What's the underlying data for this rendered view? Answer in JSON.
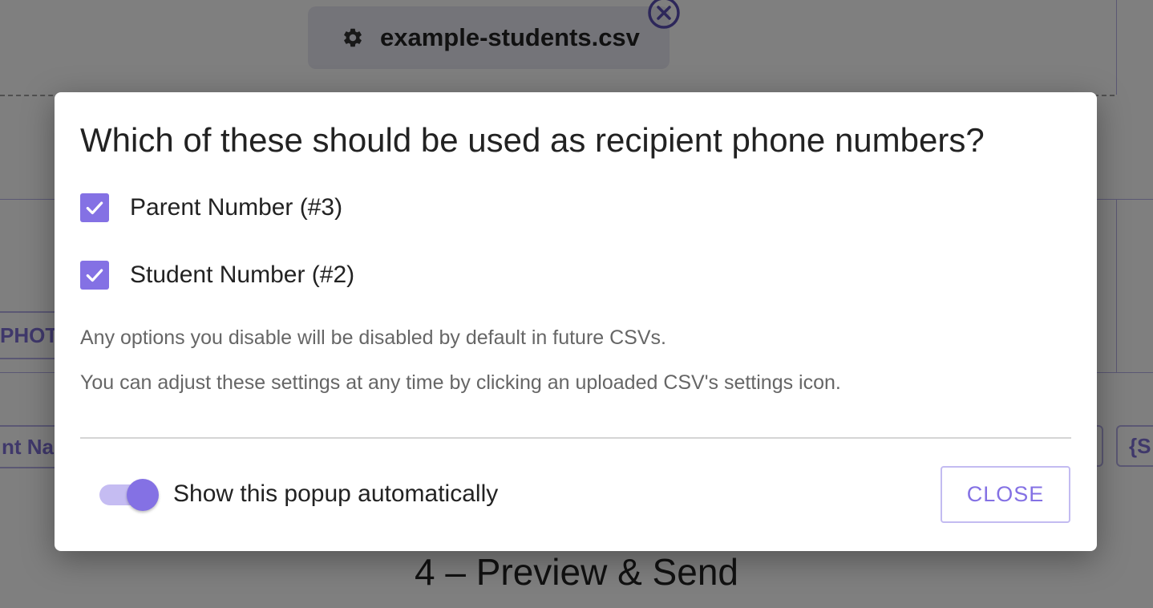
{
  "background": {
    "file_chip": {
      "filename": "example-students.csv",
      "settings_icon": "gear-icon",
      "remove_icon": "circle-x-icon"
    },
    "tags": {
      "photo_fragment": "PHOTO",
      "name_fragment": "nt Na",
      "right_fragment": "{S"
    },
    "step_heading": "4 – Preview & Send"
  },
  "dialog": {
    "title": "Which of these should be used as recipient phone numbers?",
    "options": [
      {
        "label": "Parent Number (#3)",
        "checked": true
      },
      {
        "label": "Student Number (#2)",
        "checked": true
      }
    ],
    "help_lines": [
      "Any options you disable will be disabled by default in future CSVs.",
      "You can adjust these settings at any time by clicking an uploaded CSV's settings icon."
    ],
    "toggle": {
      "label": "Show this popup automatically",
      "on": true
    },
    "close_label": "CLOSE"
  },
  "colors": {
    "accent": "#8471e4",
    "accent_light": "#c5bcf2",
    "scrim": "rgba(0,0,0,0.5)"
  }
}
